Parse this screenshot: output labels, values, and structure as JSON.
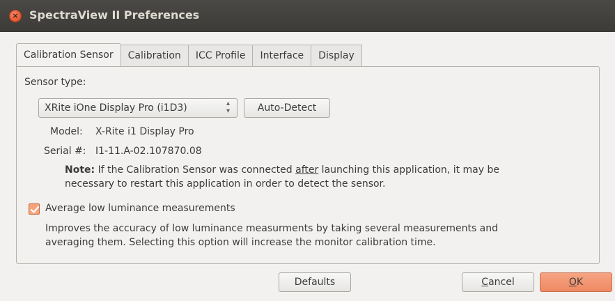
{
  "window": {
    "title": "SpectraView II Preferences",
    "close_glyph": "×"
  },
  "tabs": [
    {
      "label": "Calibration Sensor",
      "active": true
    },
    {
      "label": "Calibration",
      "active": false
    },
    {
      "label": "ICC Profile",
      "active": false
    },
    {
      "label": "Interface",
      "active": false
    },
    {
      "label": "Display",
      "active": false
    }
  ],
  "sensor": {
    "type_label": "Sensor type:",
    "selected_sensor": "XRite iOne Display Pro (i1D3)",
    "auto_detect_label": "Auto-Detect",
    "model_label": "Model:",
    "model_value": "X-Rite i1 Display Pro",
    "serial_label": "Serial #:",
    "serial_value": "I1-11.A-02.107870.08",
    "note_bold": "Note:",
    "note_part1": " If the Calibration Sensor was connected ",
    "note_underlined": "after",
    "note_part2": " launching this application, it may be",
    "note_line2": "necessary to restart this application in order to detect the sensor."
  },
  "average": {
    "checked": true,
    "label": "Average low luminance measurements",
    "desc_line1": "Improves the accuracy of low luminance measurments by taking several measurements and",
    "desc_line2": "averaging them. Selecting this option will increase the monitor calibration time."
  },
  "buttons": {
    "defaults_label": "Defaults",
    "cancel_mnemonic": "C",
    "cancel_rest": "ancel",
    "ok_mnemonic": "O",
    "ok_rest": "K"
  },
  "colors": {
    "titlebar": "#3c3b37",
    "accent": "#ee8a63",
    "close": "#e4572e"
  },
  "icons": {
    "close": "close-icon",
    "combo_arrows": "up-down-arrows-icon",
    "checkmark": "checkmark-icon"
  }
}
